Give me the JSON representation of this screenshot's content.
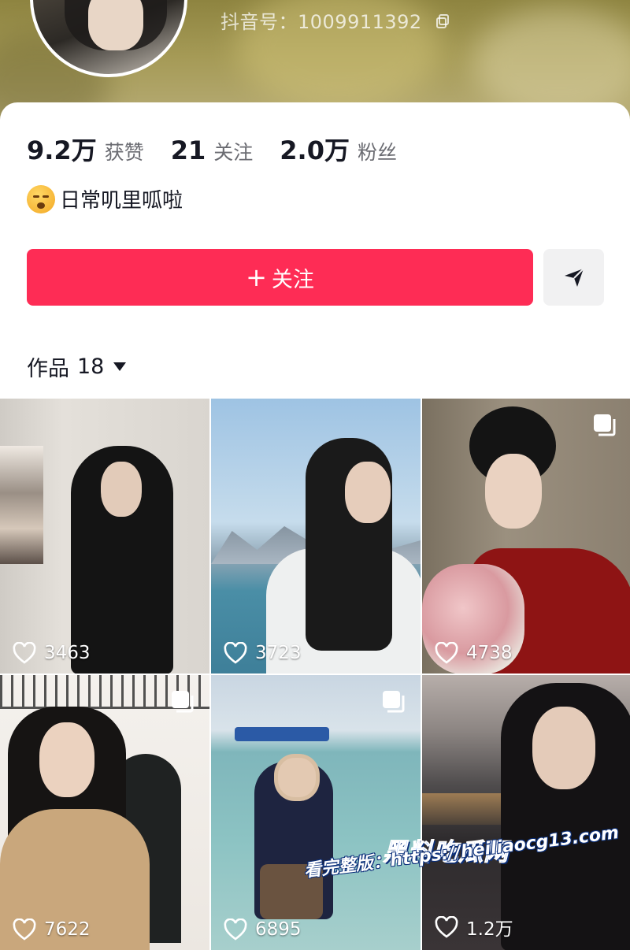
{
  "profile": {
    "douyin_id": "抖音号：1009911392",
    "stats": [
      {
        "value": "9.2万",
        "label": "获赞"
      },
      {
        "value": "21",
        "label": "关注"
      },
      {
        "value": "2.0万",
        "label": "粉丝"
      }
    ],
    "bio": "日常叽里呱啦",
    "bio_emoji": "yawning-face-emoji"
  },
  "actions": {
    "follow_plus": "+",
    "follow_label": "关注",
    "share_icon": "send-arrow-icon"
  },
  "works": {
    "label": "作品",
    "count": "18"
  },
  "videos": [
    {
      "likes": "3463",
      "multi_image": false
    },
    {
      "likes": "3723",
      "multi_image": false
    },
    {
      "likes": "4738",
      "multi_image": true
    },
    {
      "likes": "7622",
      "multi_image": true
    },
    {
      "likes": "6895",
      "multi_image": true
    },
    {
      "likes": "1.2万",
      "multi_image": false
    }
  ],
  "watermark": {
    "brand": "黑料吃瓜网",
    "text": "看完整版：https://heiliaocg13.com"
  },
  "colors": {
    "accent": "#fe2c55",
    "header": "#a59a56",
    "text": "#161823",
    "secondary_text": "#6b6c72"
  }
}
